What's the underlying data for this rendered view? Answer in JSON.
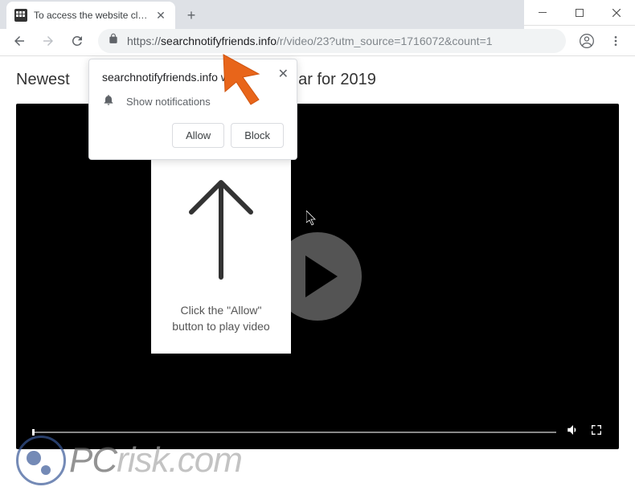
{
  "window": {
    "minimize": "—",
    "maximize": "☐",
    "close": "✕"
  },
  "tab": {
    "title": "To access the website click the \"A",
    "close": "✕"
  },
  "toolbar": {
    "back": "←",
    "forward": "→",
    "reload": "⟳",
    "url_scheme": "https://",
    "url_domain": "searchnotifyfriends.info",
    "url_path": "/r/video/23?utm_source=1716072&count=1",
    "menu": "⋮"
  },
  "page": {
    "newest_label": "Newest",
    "title_fragment": "lar for 2019"
  },
  "popup": {
    "origin": "searchnotifyfriends.info want",
    "message": "Show notifications",
    "allow_label": "Allow",
    "block_label": "Block",
    "close": "✕"
  },
  "instruction": {
    "text": "Click the \"Allow\" button to play video"
  },
  "watermark": {
    "part1": "PC",
    "part2": "risk.com"
  }
}
